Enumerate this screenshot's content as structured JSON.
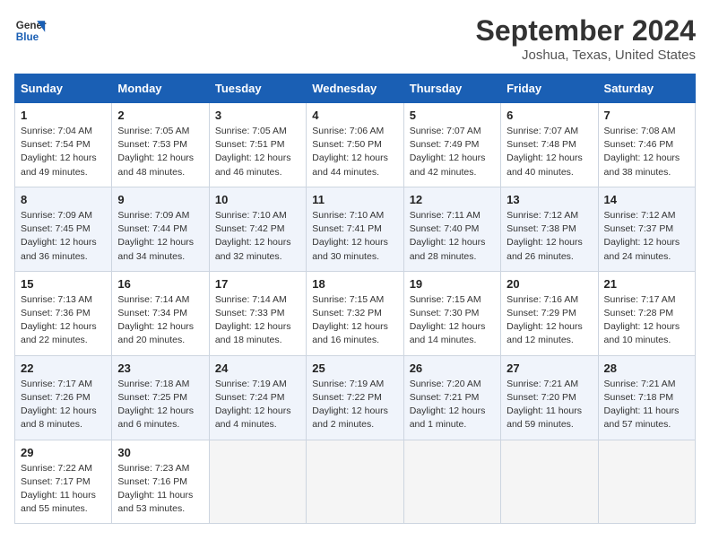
{
  "logo": {
    "line1": "General",
    "line2": "Blue"
  },
  "title": "September 2024",
  "location": "Joshua, Texas, United States",
  "days_of_week": [
    "Sunday",
    "Monday",
    "Tuesday",
    "Wednesday",
    "Thursday",
    "Friday",
    "Saturday"
  ],
  "weeks": [
    [
      {
        "day": "1",
        "sunrise": "7:04 AM",
        "sunset": "7:54 PM",
        "daylight": "12 hours and 49 minutes."
      },
      {
        "day": "2",
        "sunrise": "7:05 AM",
        "sunset": "7:53 PM",
        "daylight": "12 hours and 48 minutes."
      },
      {
        "day": "3",
        "sunrise": "7:05 AM",
        "sunset": "7:51 PM",
        "daylight": "12 hours and 46 minutes."
      },
      {
        "day": "4",
        "sunrise": "7:06 AM",
        "sunset": "7:50 PM",
        "daylight": "12 hours and 44 minutes."
      },
      {
        "day": "5",
        "sunrise": "7:07 AM",
        "sunset": "7:49 PM",
        "daylight": "12 hours and 42 minutes."
      },
      {
        "day": "6",
        "sunrise": "7:07 AM",
        "sunset": "7:48 PM",
        "daylight": "12 hours and 40 minutes."
      },
      {
        "day": "7",
        "sunrise": "7:08 AM",
        "sunset": "7:46 PM",
        "daylight": "12 hours and 38 minutes."
      }
    ],
    [
      {
        "day": "8",
        "sunrise": "7:09 AM",
        "sunset": "7:45 PM",
        "daylight": "12 hours and 36 minutes."
      },
      {
        "day": "9",
        "sunrise": "7:09 AM",
        "sunset": "7:44 PM",
        "daylight": "12 hours and 34 minutes."
      },
      {
        "day": "10",
        "sunrise": "7:10 AM",
        "sunset": "7:42 PM",
        "daylight": "12 hours and 32 minutes."
      },
      {
        "day": "11",
        "sunrise": "7:10 AM",
        "sunset": "7:41 PM",
        "daylight": "12 hours and 30 minutes."
      },
      {
        "day": "12",
        "sunrise": "7:11 AM",
        "sunset": "7:40 PM",
        "daylight": "12 hours and 28 minutes."
      },
      {
        "day": "13",
        "sunrise": "7:12 AM",
        "sunset": "7:38 PM",
        "daylight": "12 hours and 26 minutes."
      },
      {
        "day": "14",
        "sunrise": "7:12 AM",
        "sunset": "7:37 PM",
        "daylight": "12 hours and 24 minutes."
      }
    ],
    [
      {
        "day": "15",
        "sunrise": "7:13 AM",
        "sunset": "7:36 PM",
        "daylight": "12 hours and 22 minutes."
      },
      {
        "day": "16",
        "sunrise": "7:14 AM",
        "sunset": "7:34 PM",
        "daylight": "12 hours and 20 minutes."
      },
      {
        "day": "17",
        "sunrise": "7:14 AM",
        "sunset": "7:33 PM",
        "daylight": "12 hours and 18 minutes."
      },
      {
        "day": "18",
        "sunrise": "7:15 AM",
        "sunset": "7:32 PM",
        "daylight": "12 hours and 16 minutes."
      },
      {
        "day": "19",
        "sunrise": "7:15 AM",
        "sunset": "7:30 PM",
        "daylight": "12 hours and 14 minutes."
      },
      {
        "day": "20",
        "sunrise": "7:16 AM",
        "sunset": "7:29 PM",
        "daylight": "12 hours and 12 minutes."
      },
      {
        "day": "21",
        "sunrise": "7:17 AM",
        "sunset": "7:28 PM",
        "daylight": "12 hours and 10 minutes."
      }
    ],
    [
      {
        "day": "22",
        "sunrise": "7:17 AM",
        "sunset": "7:26 PM",
        "daylight": "12 hours and 8 minutes."
      },
      {
        "day": "23",
        "sunrise": "7:18 AM",
        "sunset": "7:25 PM",
        "daylight": "12 hours and 6 minutes."
      },
      {
        "day": "24",
        "sunrise": "7:19 AM",
        "sunset": "7:24 PM",
        "daylight": "12 hours and 4 minutes."
      },
      {
        "day": "25",
        "sunrise": "7:19 AM",
        "sunset": "7:22 PM",
        "daylight": "12 hours and 2 minutes."
      },
      {
        "day": "26",
        "sunrise": "7:20 AM",
        "sunset": "7:21 PM",
        "daylight": "12 hours and 1 minute."
      },
      {
        "day": "27",
        "sunrise": "7:21 AM",
        "sunset": "7:20 PM",
        "daylight": "11 hours and 59 minutes."
      },
      {
        "day": "28",
        "sunrise": "7:21 AM",
        "sunset": "7:18 PM",
        "daylight": "11 hours and 57 minutes."
      }
    ],
    [
      {
        "day": "29",
        "sunrise": "7:22 AM",
        "sunset": "7:17 PM",
        "daylight": "11 hours and 55 minutes."
      },
      {
        "day": "30",
        "sunrise": "7:23 AM",
        "sunset": "7:16 PM",
        "daylight": "11 hours and 53 minutes."
      },
      null,
      null,
      null,
      null,
      null
    ]
  ]
}
